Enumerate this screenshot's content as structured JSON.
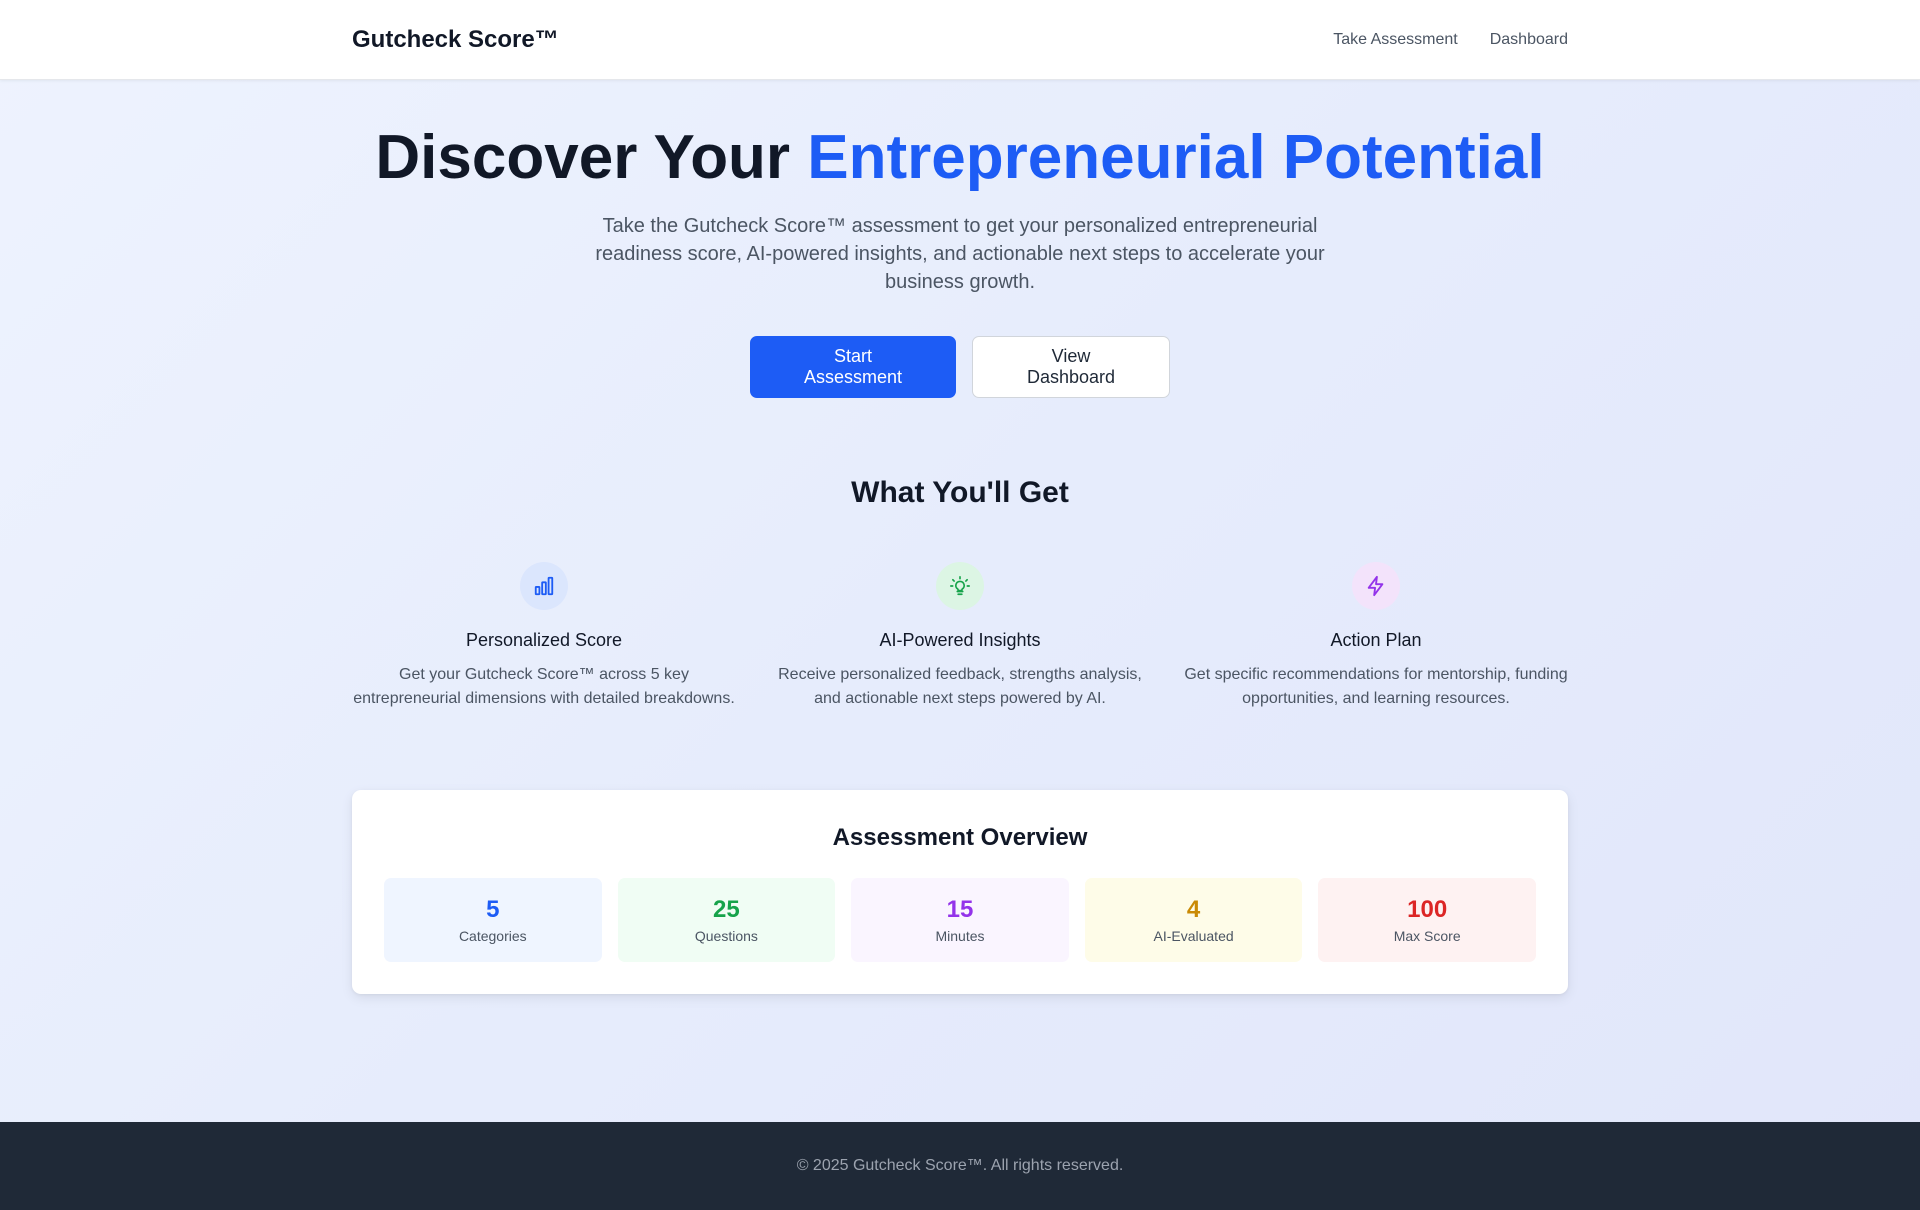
{
  "header": {
    "brand": "Gutcheck Score™",
    "nav": [
      "Take Assessment",
      "Dashboard"
    ]
  },
  "hero": {
    "title_plain": "Discover Your ",
    "title_accent": "Entrepreneurial Potential",
    "subtitle": "Take the Gutcheck Score™ assessment to get your personalized entrepreneurial readiness score, AI-powered insights, and actionable next steps to accelerate your business growth.",
    "primary_button": "Start Assessment",
    "secondary_button": "View Dashboard"
  },
  "features": {
    "title": "What You'll Get",
    "items": [
      {
        "icon": "bar-chart-icon",
        "title": "Personalized Score",
        "description": "Get your Gutcheck Score™ across 5 key entrepreneurial dimensions with detailed breakdowns.",
        "icon_color": "#1d5cf5",
        "icon_bg": "#dbe6fd"
      },
      {
        "icon": "lightbulb-icon",
        "title": "AI-Powered Insights",
        "description": "Receive personalized feedback, strengths analysis, and actionable next steps powered by AI.",
        "icon_color": "#16a34a",
        "icon_bg": "#dcf5e4"
      },
      {
        "icon": "lightning-icon",
        "title": "Action Plan",
        "description": "Get specific recommendations for mentorship, funding opportunities, and learning resources.",
        "icon_color": "#9333ea",
        "icon_bg": "#f3e3fb"
      }
    ]
  },
  "overview": {
    "title": "Assessment Overview",
    "stats": [
      {
        "value": "5",
        "label": "Categories",
        "color": "#1d5cf5",
        "bg": "#eff5ff"
      },
      {
        "value": "25",
        "label": "Questions",
        "color": "#16a34a",
        "bg": "#f0fdf4"
      },
      {
        "value": "15",
        "label": "Minutes",
        "color": "#9333ea",
        "bg": "#faf5ff"
      },
      {
        "value": "4",
        "label": "AI-Evaluated",
        "color": "#ca8a04",
        "bg": "#fefce8"
      },
      {
        "value": "100",
        "label": "Max Score",
        "color": "#dc2626",
        "bg": "#fef2f2"
      }
    ]
  },
  "footer": {
    "text": "© 2025 Gutcheck Score™. All rights reserved."
  }
}
